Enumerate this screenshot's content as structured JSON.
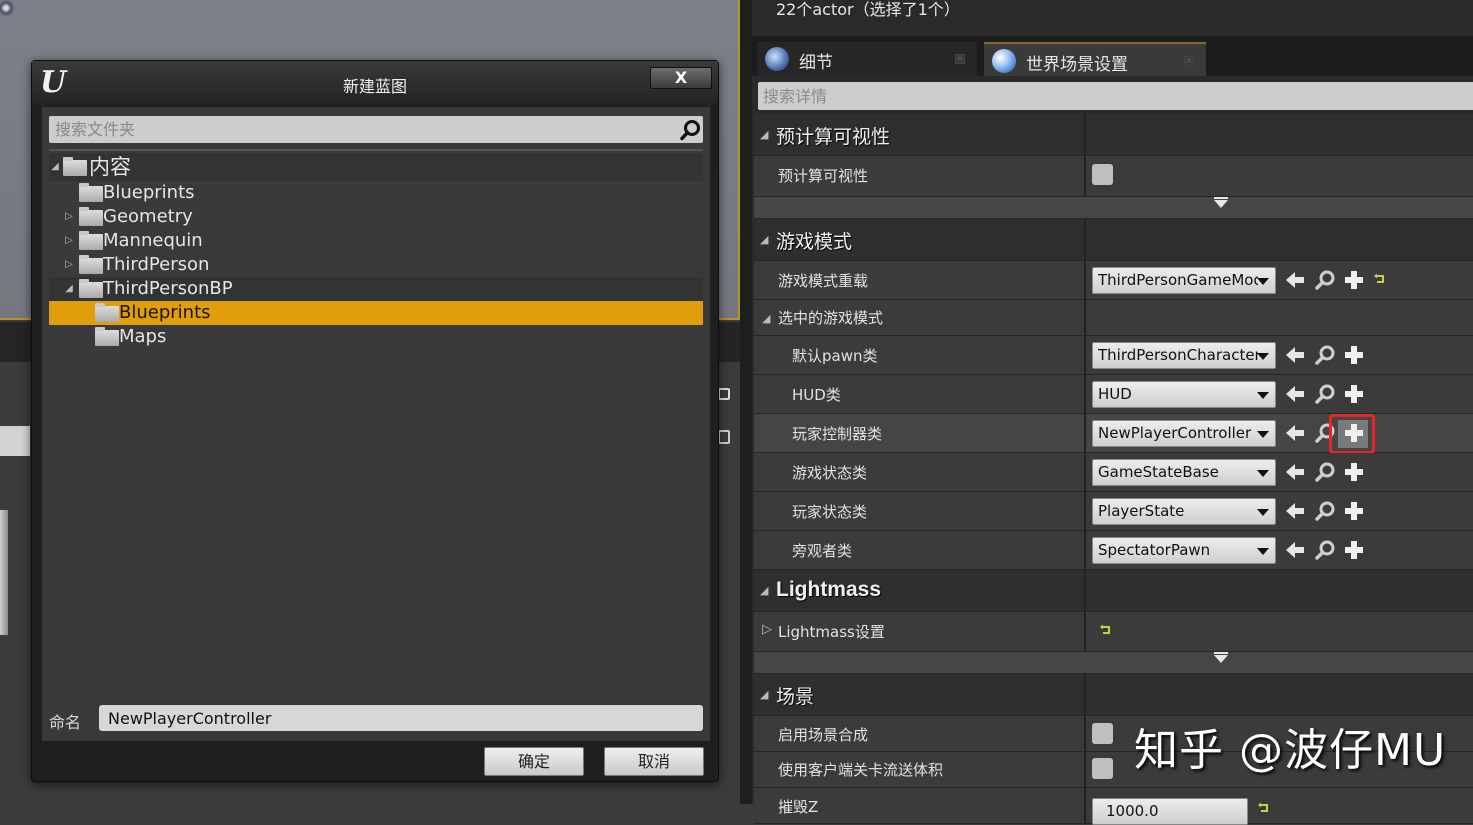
{
  "dialog": {
    "title": "新建蓝图",
    "close_label": "X",
    "search_placeholder": "搜索文件夹",
    "tree": [
      {
        "label": "内容",
        "level": 0,
        "expanded": true,
        "root": true
      },
      {
        "label": "Blueprints",
        "level": 1,
        "expandable": false
      },
      {
        "label": "Geometry",
        "level": 1,
        "expandable": true
      },
      {
        "label": "Mannequin",
        "level": 1,
        "expandable": true
      },
      {
        "label": "ThirdPerson",
        "level": 1,
        "expandable": true
      },
      {
        "label": "ThirdPersonBP",
        "level": 1,
        "expanded": true
      },
      {
        "label": "Blueprints",
        "level": 2,
        "selected": true
      },
      {
        "label": "Maps",
        "level": 2
      }
    ],
    "name_label": "命名",
    "name_value": "NewPlayerController",
    "ok_label": "确定",
    "cancel_label": "取消"
  },
  "details": {
    "actor_count": "22个actor（选择了1个）",
    "tabs": [
      {
        "label": "细节",
        "icon": "info-icon",
        "active": false
      },
      {
        "label": "世界场景设置",
        "icon": "globe-icon",
        "active": true
      }
    ],
    "search_placeholder": "搜索详情",
    "sections": {
      "precomputed": {
        "title": "预计算可视性",
        "prop_label": "预计算可视性",
        "checked": false
      },
      "gamemode": {
        "title": "游戏模式",
        "override_label": "游戏模式重载",
        "override_value": "ThirdPersonGameMode",
        "selected_label": "选中的游戏模式",
        "classes": [
          {
            "label": "默认pawn类",
            "value": "ThirdPersonCharacter"
          },
          {
            "label": "HUD类",
            "value": "HUD"
          },
          {
            "label": "玩家控制器类",
            "value": "NewPlayerController",
            "highlighted": true
          },
          {
            "label": "游戏状态类",
            "value": "GameStateBase"
          },
          {
            "label": "玩家状态类",
            "value": "PlayerState"
          },
          {
            "label": "旁观者类",
            "value": "SpectatorPawn"
          }
        ]
      },
      "lightmass": {
        "title": "Lightmass",
        "settings_label": "Lightmass设置"
      },
      "world": {
        "title": "场景",
        "props": [
          {
            "label": "启用场景合成",
            "checked": false
          },
          {
            "label": "使用客户端关卡流送体积",
            "checked": false
          },
          {
            "label": "摧毁Z",
            "value": "1000.0"
          }
        ]
      }
    }
  },
  "watermark": "知乎 @波仔MU",
  "colors": {
    "selection": "#e09e0b",
    "highlight_box": "#e8262a",
    "reset_arrow": "#c8d040"
  }
}
